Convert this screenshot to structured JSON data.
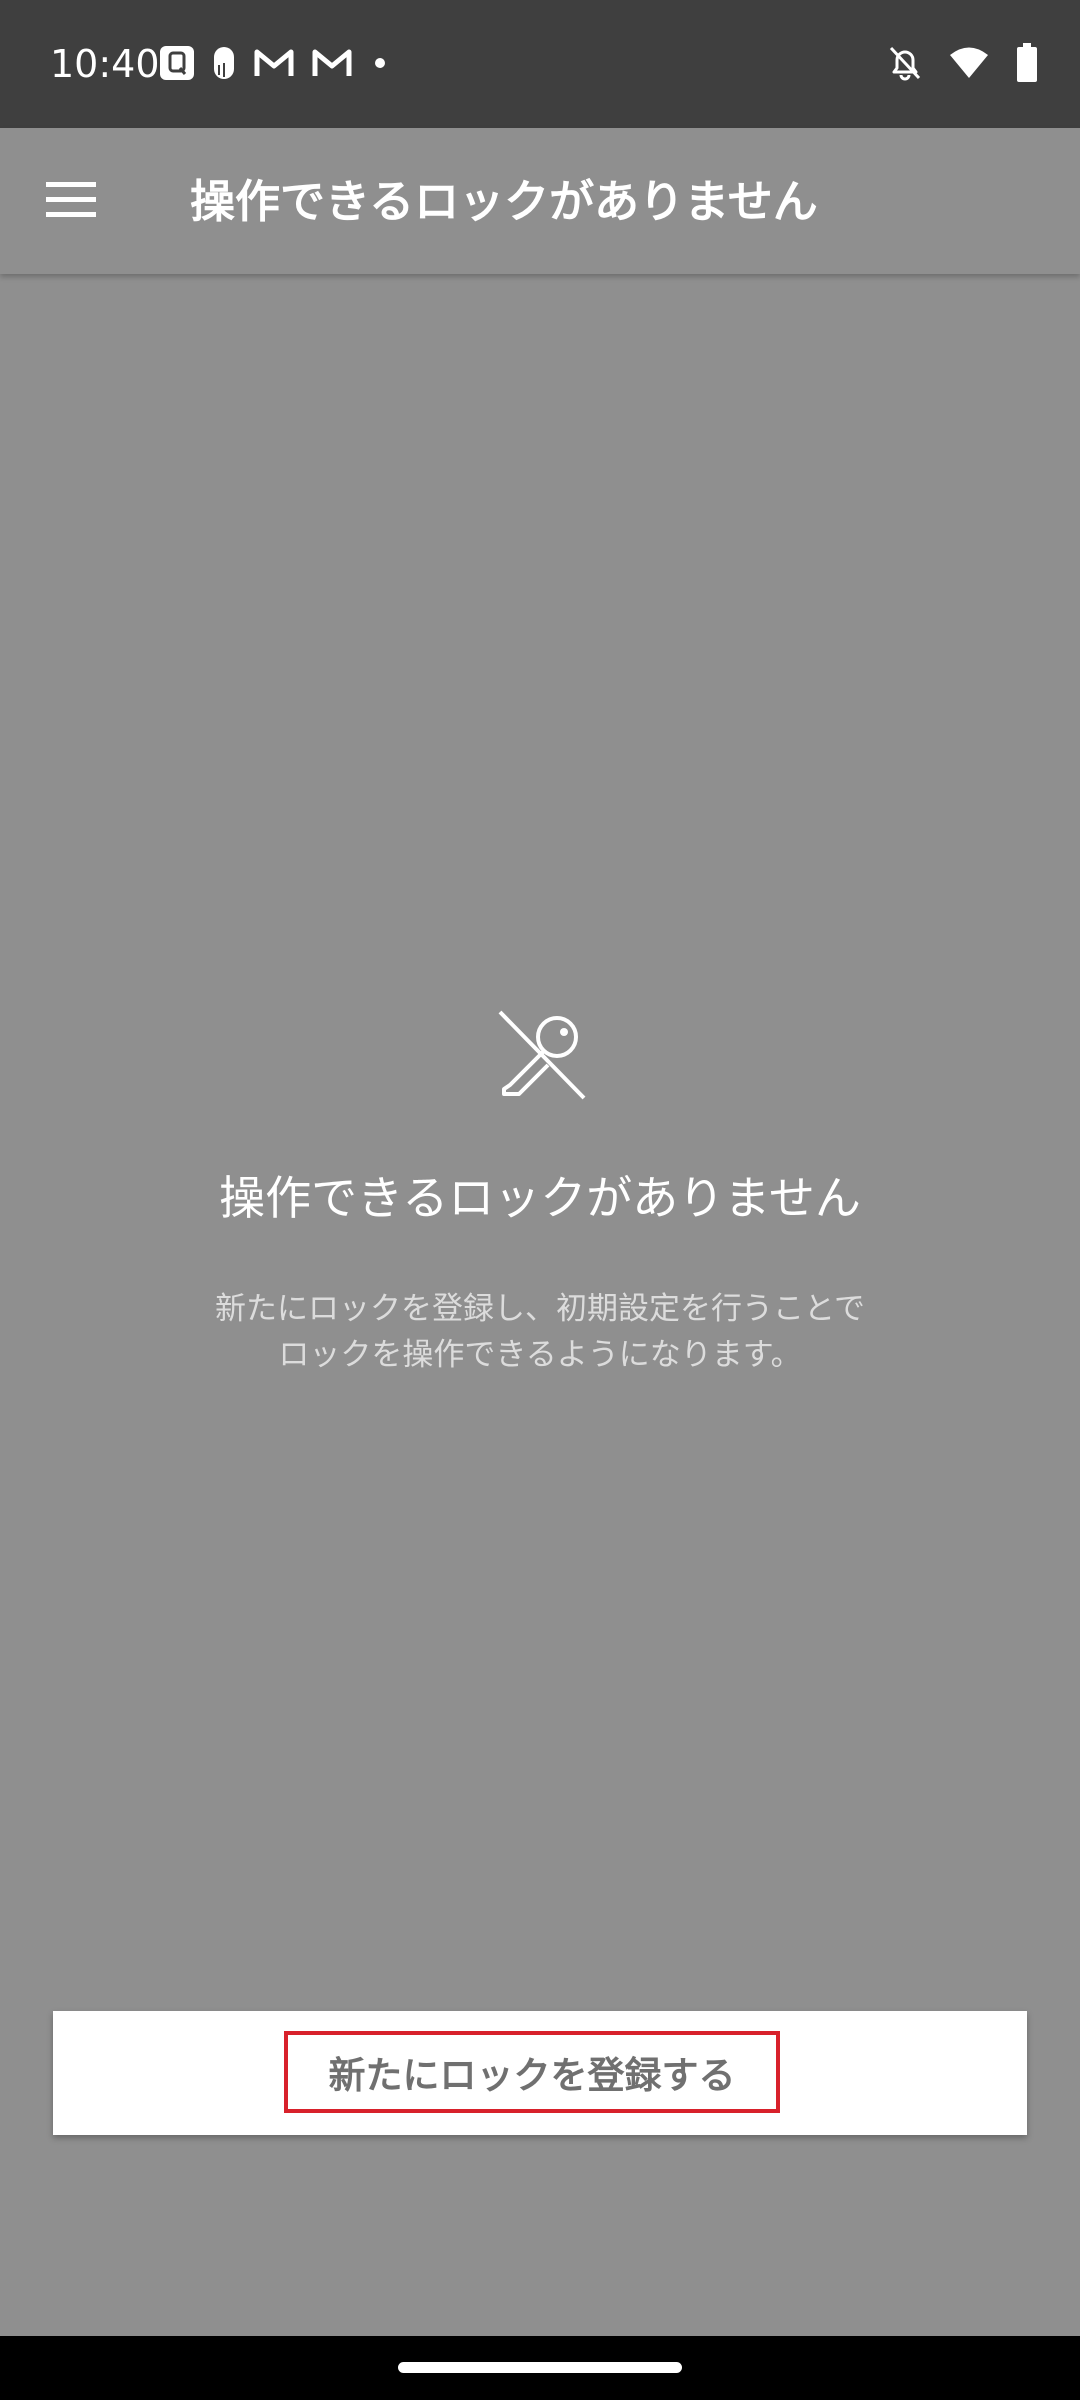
{
  "status_bar": {
    "time": "10:40",
    "left_icons": [
      "q-app-icon",
      "finger-app-icon",
      "gmail-icon",
      "gmail-icon",
      "notification-dot-icon"
    ],
    "right_icons": [
      "notifications-off-icon",
      "wifi-icon",
      "battery-icon"
    ]
  },
  "app_bar": {
    "title": "操作できるロックがありません",
    "menu_icon": "menu-icon"
  },
  "empty_state": {
    "icon": "no-key-icon",
    "title": "操作できるロックがありません",
    "description": "新たにロックを登録し、初期設定を行うことでロックを操作できるようになります。"
  },
  "register": {
    "label": "新たにロックを登録する",
    "highlight_color": "#d8212b"
  },
  "colors": {
    "background": "#8f8f8f",
    "status_bar": "#3f3f3f",
    "text_primary": "#ffffff",
    "button_text": "#707070"
  }
}
